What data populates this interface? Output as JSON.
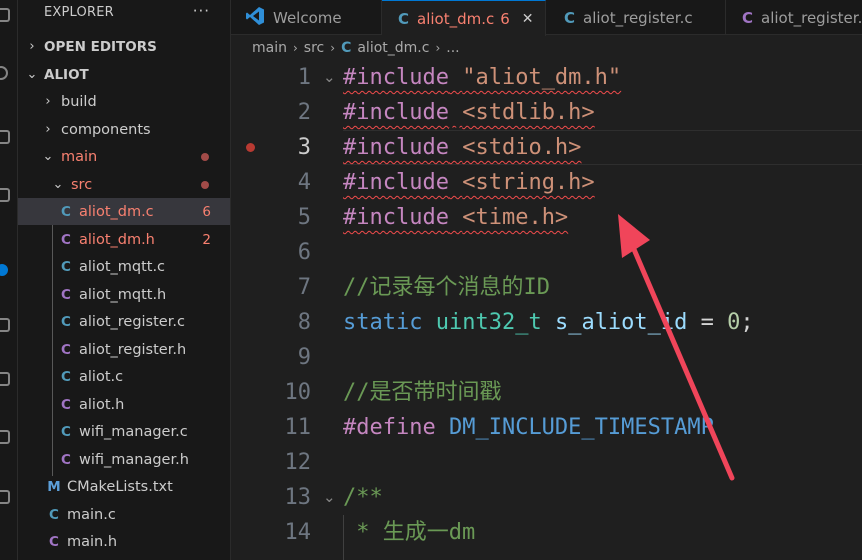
{
  "sidebar": {
    "title": "EXPLORER",
    "more": "···",
    "sections": {
      "open_editors": "OPEN EDITORS",
      "project": "ALIOT"
    },
    "tree": {
      "build": "build",
      "components": "components",
      "main": "main",
      "src": "src",
      "files": [
        {
          "icon": "C",
          "name": "aliot_dm.c",
          "badge": "6"
        },
        {
          "icon": "C",
          "name": "aliot_dm.h",
          "badge": "2"
        },
        {
          "icon": "C",
          "name": "aliot_mqtt.c"
        },
        {
          "icon": "C",
          "name": "aliot_mqtt.h"
        },
        {
          "icon": "C",
          "name": "aliot_register.c"
        },
        {
          "icon": "C",
          "name": "aliot_register.h"
        },
        {
          "icon": "C",
          "name": "aliot.c"
        },
        {
          "icon": "C",
          "name": "aliot.h"
        },
        {
          "icon": "C",
          "name": "wifi_manager.c"
        },
        {
          "icon": "C",
          "name": "wifi_manager.h"
        }
      ],
      "cmake": {
        "icon": "M",
        "name": "CMakeLists.txt"
      },
      "main_c": {
        "icon": "C",
        "name": "main.c"
      },
      "main_h": {
        "icon": "C",
        "name": "main.h"
      }
    }
  },
  "tabs": [
    {
      "icon": "vscode-icon",
      "label": "Welcome"
    },
    {
      "icon": "C",
      "label": "aliot_dm.c",
      "badge": "6",
      "close": "✕"
    },
    {
      "icon": "C",
      "label": "aliot_register.c"
    },
    {
      "icon": "C",
      "label": "aliot_register.h"
    }
  ],
  "breadcrumb": {
    "parts": [
      "main",
      "src"
    ],
    "file_icon": "C",
    "file": "aliot_dm.c",
    "tail": "..."
  },
  "editor": {
    "line_numbers": [
      "1",
      "2",
      "3",
      "4",
      "5",
      "6",
      "7",
      "8",
      "9",
      "10",
      "11",
      "12",
      "13",
      "14"
    ],
    "lines": {
      "l1": {
        "kw": "#include",
        "rest": "\"aliot_dm.h\""
      },
      "l2": {
        "kw": "#include",
        "rest": "<stdlib.h>"
      },
      "l3": {
        "kw": "#include",
        "rest": "<stdio.h>"
      },
      "l4": {
        "kw": "#include",
        "rest": "<string.h>"
      },
      "l5": {
        "kw": "#include",
        "rest": "<time.h>"
      },
      "l7": {
        "comment": "//记录每个消息的ID"
      },
      "l8": {
        "kw": "static",
        "type": "uint32_t",
        "var": "s_aliot_id",
        "op": "=",
        "num": "0",
        "end": ";"
      },
      "l10": {
        "comment": "//是否带时间戳"
      },
      "l11": {
        "kw": "#define",
        "macro": "DM_INCLUDE_TIMESTAMP"
      },
      "l13": {
        "comment": "/**"
      },
      "l14": {
        "comment": " * 生成一dm"
      }
    }
  },
  "colors": {
    "annotation_arrow": "#f0455a",
    "accent": "#0078d4",
    "error": "#f88070"
  }
}
